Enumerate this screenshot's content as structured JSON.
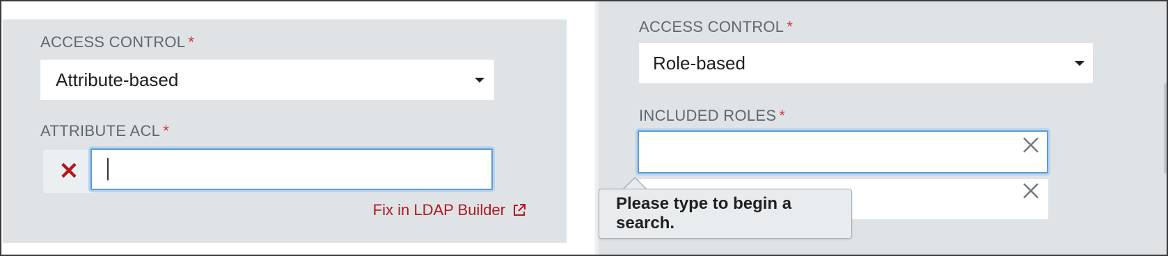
{
  "left": {
    "access_control_label": "ACCESS CONTROL",
    "access_control_value": "Attribute-based",
    "attribute_acl_label": "ATTRIBUTE ACL",
    "attribute_acl_value": "",
    "fix_link": "Fix in LDAP Builder",
    "required_mark": "*"
  },
  "right": {
    "access_control_label": "ACCESS CONTROL",
    "access_control_value": "Role-based",
    "included_roles_label": "INCLUDED ROLES",
    "included_roles_value": "",
    "tooltip_text": "Please type to begin a search.",
    "required_mark": "*"
  },
  "colors": {
    "panel_bg": "#dfe3e6",
    "required": "#d0343a",
    "link": "#b3181e",
    "focus_border": "#5b9bd5"
  },
  "icons": [
    "remove-x-icon",
    "external-link-icon",
    "close-icon",
    "caret-down-icon"
  ]
}
